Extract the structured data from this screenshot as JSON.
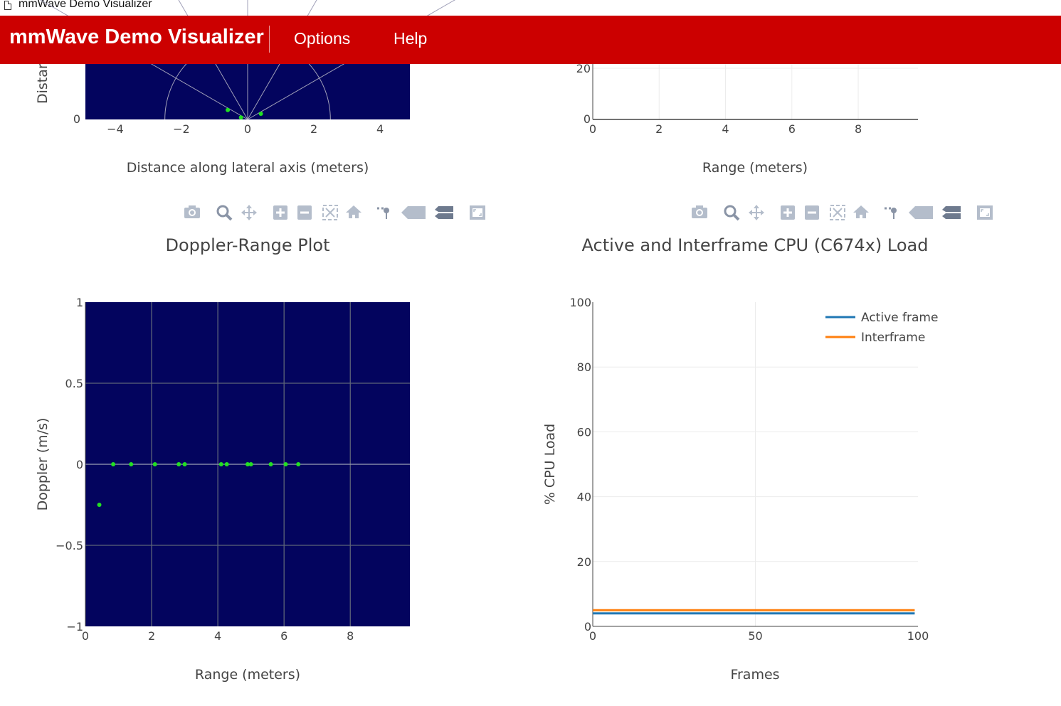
{
  "window_title": "mmWave Demo Visualizer",
  "app": {
    "brand": "mmWave Demo Visualizer",
    "menu": [
      "Options",
      "Help"
    ]
  },
  "colors": {
    "accent": "#cc0000",
    "plot_bg": "#03045e",
    "point": "#22e022",
    "active": "#1f77b4",
    "interframe": "#ff7f0e"
  },
  "modebar_icons": [
    "camera-icon",
    "zoom-icon",
    "pan-icon",
    "zoom-in-icon",
    "zoom-out-icon",
    "autoscale-icon",
    "home-icon",
    "spike-lines-icon",
    "hover-closest-icon",
    "hover-compare-icon",
    "fullscreen-icon"
  ],
  "scatter_plot": {
    "ylabel_visible": "Distar",
    "xlabel": "Distance along lateral axis (meters)",
    "x_ticks": [
      "−4",
      "−2",
      "0",
      "2",
      "4"
    ],
    "y_ticks": [
      "0"
    ],
    "points": [
      [
        -0.6,
        0.63
      ],
      [
        0.4,
        0.38
      ],
      [
        -0.2,
        0.13
      ]
    ]
  },
  "range_profile": {
    "xlabel": "Range (meters)",
    "x_ticks": [
      "0",
      "2",
      "4",
      "6",
      "8"
    ],
    "y_ticks": [
      "20",
      "0"
    ]
  },
  "doppler_plot": {
    "title": "Doppler-Range Plot",
    "xlabel": "Range (meters)",
    "ylabel": "Doppler (m/s)",
    "x_ticks": [
      "0",
      "2",
      "4",
      "6",
      "8"
    ],
    "y_ticks": [
      "1",
      "0.5",
      "0",
      "−0.5",
      "−1"
    ]
  },
  "cpu_plot": {
    "title": "Active and Interframe  CPU (C674x) Load",
    "xlabel": "Frames",
    "ylabel": "% CPU Load",
    "x_ticks": [
      "0",
      "50",
      "100"
    ],
    "y_ticks": [
      "100",
      "80",
      "60",
      "40",
      "20",
      "0"
    ],
    "legend": [
      "Active frame",
      "Interframe"
    ]
  },
  "chart_data": [
    {
      "type": "scatter",
      "xlabel": "Distance along lateral axis (meters)",
      "ylabel": "Distar",
      "points": [
        {
          "x": -0.6,
          "y": 0.63
        },
        {
          "x": 0.4,
          "y": 0.38
        },
        {
          "x": -0.2,
          "y": 0.13
        }
      ]
    },
    {
      "type": "line",
      "xlabel": "Range (meters)",
      "xlim": [
        0,
        9.8
      ]
    },
    {
      "type": "scatter",
      "title": "Doppler-Range Plot",
      "xlabel": "Range (meters)",
      "ylabel": "Doppler (m/s)",
      "xlim": [
        0,
        9.8
      ],
      "ylim": [
        -1,
        1
      ],
      "grid": true,
      "x": [
        0.42,
        0.84,
        1.38,
        2.1,
        2.82,
        3.0,
        4.1,
        4.27,
        4.9,
        5.0,
        5.6,
        6.05,
        6.43
      ],
      "y": [
        -0.25,
        0,
        0,
        0,
        0,
        0,
        0,
        0,
        0,
        0,
        0,
        0,
        0
      ]
    },
    {
      "type": "line",
      "title": "Active and Interframe  CPU (C674x) Load",
      "xlabel": "Frames",
      "ylabel": "% CPU Load",
      "xlim": [
        0,
        100
      ],
      "ylim": [
        0,
        100
      ],
      "legend_position": "top-right",
      "series": [
        {
          "name": "Active frame",
          "x": [
            0,
            99
          ],
          "values": [
            4,
            4
          ]
        },
        {
          "name": "Interframe",
          "x": [
            0,
            99
          ],
          "values": [
            5,
            5
          ]
        }
      ]
    }
  ]
}
